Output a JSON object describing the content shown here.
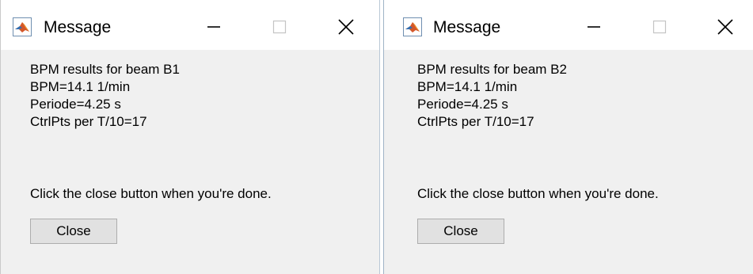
{
  "dialogs": [
    {
      "title": "Message",
      "lines": [
        "BPM results for beam B1",
        "BPM=14.1 1/min",
        "Periode=4.25 s",
        "CtrlPts per T/10=17"
      ],
      "prompt": "Click the close button when you're done.",
      "close_label": "Close"
    },
    {
      "title": "Message",
      "lines": [
        "BPM results for beam B2",
        "BPM=14.1 1/min",
        "Periode=4.25 s",
        "CtrlPts per T/10=17"
      ],
      "prompt": "Click the close button when you're done.",
      "close_label": "Close"
    }
  ],
  "icons": {
    "app": "matlab-icon",
    "minimize": "minimize-icon",
    "maximize": "maximize-icon",
    "close": "close-icon"
  },
  "colors": {
    "titlebar": "#ffffff",
    "dialog_body": "#f0f0f0",
    "button_face": "#e1e1e1",
    "button_border": "#adadad"
  }
}
